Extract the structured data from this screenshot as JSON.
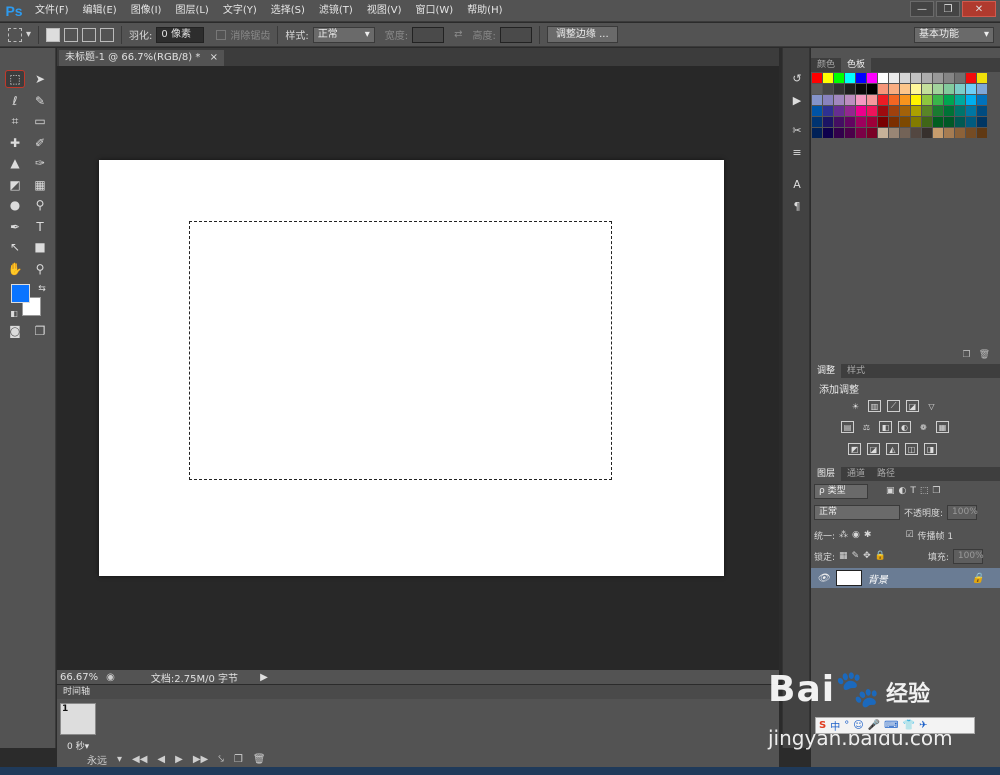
{
  "app": {
    "logo": "Ps"
  },
  "menu": [
    "文件(F)",
    "编辑(E)",
    "图像(I)",
    "图层(L)",
    "文字(Y)",
    "选择(S)",
    "滤镜(T)",
    "视图(V)",
    "窗口(W)",
    "帮助(H)"
  ],
  "window_controls": {
    "minimize": "—",
    "restore": "❐",
    "close": "✕"
  },
  "options": {
    "feather_label": "羽化:",
    "feather_value": "0 像素",
    "antialias_label": "消除锯齿",
    "style_label": "样式:",
    "style_value": "正常",
    "width_label": "宽度:",
    "height_label": "高度:",
    "refine_edge": "调整边缘 ...",
    "workspace": "基本功能"
  },
  "document": {
    "tab": "未标题-1 @ 66.7%(RGB/8) *",
    "close": "×"
  },
  "status": {
    "zoom": "66.67%",
    "doc_info": "文档:2.75M/0 字节"
  },
  "timeline": {
    "title": "时间轴",
    "frame_number": "1",
    "frame_delay": "0 秒▾",
    "loop": "永远"
  },
  "panels": {
    "color_tab": "颜色",
    "swatches_tab": "色板",
    "adjustments_tab": "调整",
    "styles_tab": "样式",
    "add_adjustment": "添加调整",
    "layers_tab": "图层",
    "channels_tab": "通道",
    "paths_tab": "路径",
    "kind_filter": "ρ 类型",
    "blend_mode": "正常",
    "opacity_label": "不透明度:",
    "opacity_value": "100%",
    "unify_label": "统一:",
    "propagate_label": "传播帧 1",
    "lock_label": "锁定:",
    "fill_label": "填充:",
    "fill_value": "100%",
    "layer_name": "背景"
  },
  "colors": {
    "fg": "#0a74ff",
    "bg": "#ffffff",
    "accent_ps": "#2d9bf0",
    "swatches": [
      "#ff0000",
      "#ffff00",
      "#00ff00",
      "#00ffff",
      "#0000ff",
      "#ff00ff",
      "#ffffff",
      "#ebebeb",
      "#d6d6d6",
      "#c2c2c2",
      "#adadad",
      "#999999",
      "#858585",
      "#707070",
      "#f20c0c",
      "#f0e00a",
      "#5c5c5c",
      "#474747",
      "#333333",
      "#1f1f1f",
      "#0a0a0a",
      "#000000",
      "#f7977a",
      "#f9ad81",
      "#fdc68a",
      "#fff79a",
      "#c4df9b",
      "#a2d39c",
      "#82ca9d",
      "#7bcdc8",
      "#6ecff6",
      "#7ea7d8",
      "#8493ca",
      "#8882be",
      "#a187be",
      "#bc8dbf",
      "#f49ac2",
      "#f6989d",
      "#ed1c24",
      "#f26522",
      "#f7941d",
      "#fff200",
      "#8dc63f",
      "#39b54a",
      "#00a651",
      "#00a99d",
      "#00aeef",
      "#0072bc",
      "#0054a6",
      "#2e3192",
      "#662d91",
      "#92278f",
      "#ec008c",
      "#ed145b",
      "#9e0b0f",
      "#a0410d",
      "#a36209",
      "#aba000",
      "#598527",
      "#1a7b30",
      "#007236",
      "#00746b",
      "#0076a3",
      "#004b80",
      "#003471",
      "#1b1464",
      "#440e62",
      "#630460",
      "#9e005d",
      "#9e0039",
      "#790000",
      "#7b2e00",
      "#7d4900",
      "#827b00",
      "#406618",
      "#005e20",
      "#005826",
      "#005952",
      "#005b7f",
      "#003663",
      "#002157",
      "#0d004c",
      "#32004b",
      "#4b0049",
      "#7b0046",
      "#7a0026",
      "#c7b299",
      "#998675",
      "#736357",
      "#534741",
      "#37302d",
      "#c69c6d",
      "#a67c52",
      "#8c6239",
      "#754c24",
      "#603913"
    ]
  }
}
